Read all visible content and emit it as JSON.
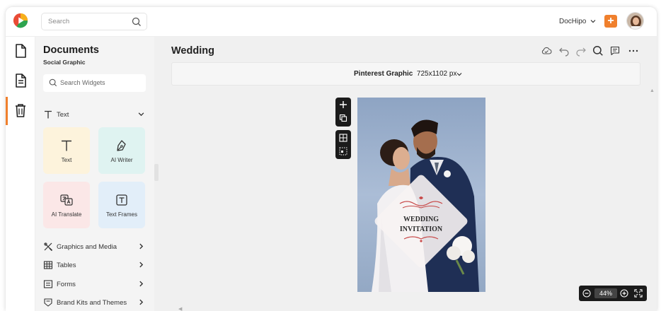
{
  "header": {
    "search_placeholder": "Search",
    "account_name": "DocHipo",
    "add_label": "+"
  },
  "rail": {
    "items": [
      "documents-icon",
      "widgets-icon",
      "trash-icon"
    ],
    "active": "widgets-icon"
  },
  "panel": {
    "title": "Documents",
    "subtitle": "Social Graphic",
    "search_placeholder": "Search Widgets",
    "text_section": "Text",
    "cards": [
      {
        "label": "Text",
        "bg": "#fdf3dc"
      },
      {
        "label": "AI Writer",
        "bg": "#dff3f1"
      },
      {
        "label": "AI Translate",
        "bg": "#fbe7e7"
      },
      {
        "label": "Text Frames",
        "bg": "#e2eef9"
      }
    ],
    "sections": [
      "Graphics and Media",
      "Tables",
      "Forms",
      "Brand Kits and Themes"
    ]
  },
  "main": {
    "doc_title": "Wedding",
    "format_name": "Pinterest Graphic",
    "format_size": "725x1102 px",
    "zoom": "44%"
  },
  "design": {
    "line1": "WEDDING",
    "line2": "INVITATION",
    "accent": "#c84a4a"
  },
  "colors": {
    "brand_orange": "#f0802d"
  }
}
